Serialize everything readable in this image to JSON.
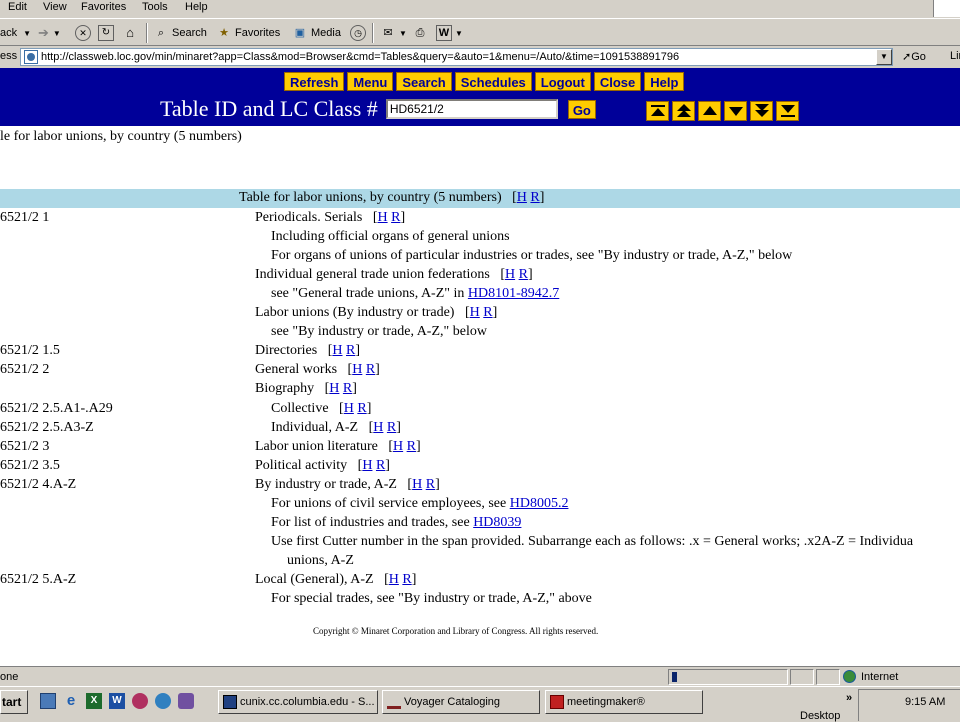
{
  "menubar": {
    "items": [
      "Edit",
      "View",
      "Favorites",
      "Tools",
      "Help"
    ]
  },
  "toolbar": {
    "back_label": "ack",
    "search_label": "Search",
    "favorites_label": "Favorites",
    "media_label": "Media"
  },
  "address": {
    "label": "ess",
    "url": "http://classweb.loc.gov/min/minaret?app=Class&mod=Browser&cmd=Tables&query=&auto=1&menu=/Auto/&time=1091538891796",
    "go_label": "Go",
    "links_label": "Lin"
  },
  "app": {
    "nav_buttons": [
      "Refresh",
      "Menu",
      "Search",
      "Schedules",
      "Logout",
      "Close",
      "Help"
    ],
    "title": "Table ID and LC Class #",
    "class_input_value": "HD6521/2",
    "go_label": "Go",
    "arrow_buttons": [
      "top-icon",
      "page-up-icon",
      "up-icon",
      "down-icon",
      "page-down-icon",
      "bottom-icon"
    ]
  },
  "breadcrumb": "le for labor unions, by country (5 numbers)",
  "table_header": {
    "text": "Table for labor unions, by country (5 numbers)",
    "h": "H",
    "r": "R"
  },
  "rows": [
    {
      "num": "6521/2 1",
      "indent": 0,
      "text": "Periodicals. Serials",
      "hr": true
    },
    {
      "num": "",
      "indent": 1,
      "text": "Including official organs of general unions",
      "hr": false
    },
    {
      "num": "",
      "indent": 1,
      "text": "For organs of unions of particular industries or trades, see \"By industry or trade, A-Z,\" below",
      "hr": false
    },
    {
      "num": "",
      "indent": 0,
      "text": "Individual general trade union federations",
      "hr": true
    },
    {
      "num": "",
      "indent": 1,
      "text": "see \"General trade unions, A-Z\" in ",
      "link": "HD8101-8942.7",
      "hr": false
    },
    {
      "num": "",
      "indent": 0,
      "text": "Labor unions (By industry or trade)",
      "hr": true
    },
    {
      "num": "",
      "indent": 1,
      "text": "see \"By industry or trade, A-Z,\" below",
      "hr": false
    },
    {
      "num": "6521/2 1.5",
      "indent": 0,
      "text": "Directories",
      "hr": true
    },
    {
      "num": "6521/2 2",
      "indent": 0,
      "text": "General works",
      "hr": true
    },
    {
      "num": "",
      "indent": 0,
      "text": "Biography",
      "hr": true
    },
    {
      "num": "6521/2 2.5.A1-.A29",
      "indent": 1,
      "text": "Collective",
      "hr": true
    },
    {
      "num": "6521/2 2.5.A3-Z",
      "indent": 1,
      "text": "Individual, A-Z",
      "hr": true
    },
    {
      "num": "6521/2 3",
      "indent": 0,
      "text": "Labor union literature",
      "hr": true
    },
    {
      "num": "6521/2 3.5",
      "indent": 0,
      "text": "Political activity",
      "hr": true
    },
    {
      "num": "6521/2 4.A-Z",
      "indent": 0,
      "text": "By industry or trade, A-Z",
      "hr": true
    },
    {
      "num": "",
      "indent": 1,
      "text": "For unions of civil service employees, see ",
      "link": "HD8005.2",
      "hr": false
    },
    {
      "num": "",
      "indent": 1,
      "text": "For list of industries and trades, see ",
      "link": "HD8039",
      "hr": false
    },
    {
      "num": "",
      "indent": 1,
      "text": "Use first Cutter number in the span provided. Subarrange each as follows: .x = General works; .x2A-Z = Individua",
      "hr": false
    },
    {
      "num": "",
      "indent": 2,
      "text": "unions, A-Z",
      "hr": false
    },
    {
      "num": "6521/2 5.A-Z",
      "indent": 0,
      "text": "Local (General), A-Z",
      "hr": true
    },
    {
      "num": "",
      "indent": 1,
      "text": "For special trades, see \"By industry or trade, A-Z,\" above",
      "hr": false
    }
  ],
  "hr_labels": {
    "h": "H",
    "r": "R"
  },
  "copyright": "Copyright © Minaret Corporation and Library of Congress. All rights reserved.",
  "status": {
    "text": "one",
    "zone": "Internet"
  },
  "taskbar": {
    "start_label": "tart",
    "items": [
      "cunix.cc.columbia.edu - S...",
      "Voyager Cataloging",
      "meetingmaker®"
    ],
    "desktop_label": "Desktop",
    "clock": "9:15 AM"
  },
  "colors": {
    "header_bg": "#000099",
    "button_bg": "#ffcc00",
    "table_bar_bg": "#add8e6",
    "link": "#0000cc"
  }
}
